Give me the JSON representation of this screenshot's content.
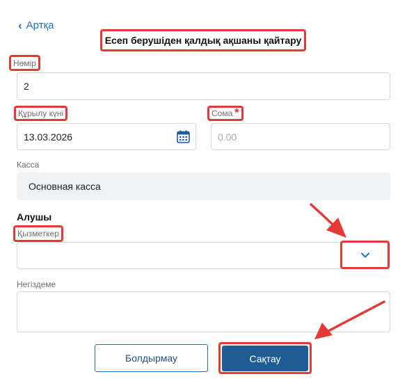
{
  "header": {
    "back_label": "Артқа",
    "title": "Есеп берушіден қалдық ақшаны қайтару"
  },
  "form": {
    "number": {
      "label": "Нөмір",
      "value": "2"
    },
    "created_date": {
      "label": "Құрылу күні",
      "value": "13.03.2026"
    },
    "amount": {
      "label": "Сома",
      "required_mark": "*",
      "placeholder": "0.00"
    },
    "cashbox": {
      "label": "Касса",
      "value": "Основная касса"
    },
    "recipient_section": "Алушы",
    "employee": {
      "label": "Қызметкер",
      "value": ""
    },
    "basis": {
      "label": "Негіздеме",
      "value": ""
    }
  },
  "buttons": {
    "cancel_label": "Болдырмау",
    "save_label": "Сақтау"
  },
  "colors": {
    "accent": "#1f6fc4",
    "primary_button": "#1f5c96",
    "annotation": "#e53935",
    "readonly_bg": "#eff2f5"
  }
}
